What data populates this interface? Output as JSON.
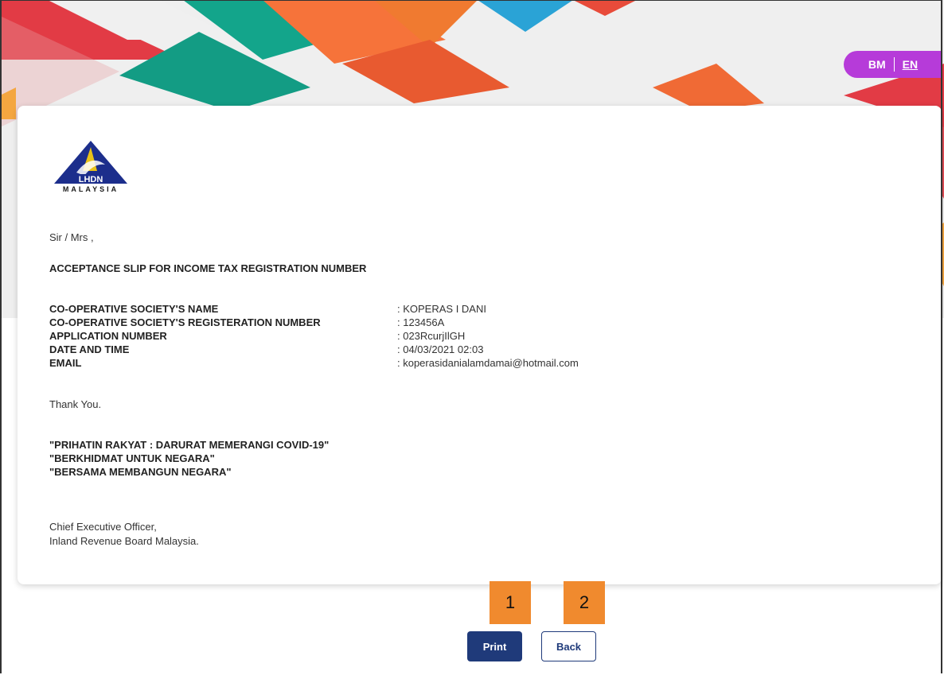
{
  "language_toggle": {
    "bm": "BM",
    "en": "EN"
  },
  "logo": {
    "text": "MALAYSIA",
    "lettering": "LHDN"
  },
  "letter": {
    "salutation": "Sir / Mrs ,",
    "heading": "ACCEPTANCE SLIP FOR INCOME TAX REGISTRATION NUMBER",
    "fields": [
      {
        "label": "CO-OPERATIVE SOCIETY'S NAME",
        "value": ": KOPERAS I DANI"
      },
      {
        "label": "CO-OPERATIVE SOCIETY'S REGISTERATION NUMBER",
        "value": ": 123456A"
      },
      {
        "label": "APPLICATION NUMBER",
        "value": ": 023RcurjIlGH"
      },
      {
        "label": "DATE AND TIME",
        "value": ": 04/03/2021 02:03"
      },
      {
        "label": "EMAIL",
        "value": ": koperasidanialamdamai@hotmail.com"
      }
    ],
    "thanks": "Thank You.",
    "slogans": [
      "\"PRIHATIN RAKYAT : DARURAT MEMERANGI COVID-19\"",
      "\"BERKHIDMAT UNTUK NEGARA\"",
      "\"BERSAMA MEMBANGUN NEGARA\""
    ],
    "signoff": [
      "Chief Executive Officer,",
      "Inland Revenue Board Malaysia."
    ]
  },
  "buttons": {
    "print": "Print",
    "back": "Back"
  },
  "markers": [
    "1",
    "2"
  ],
  "colors": {
    "primary": "#1f3a7a",
    "toggle": "#b63bd9",
    "marker": "#f08a2e"
  }
}
